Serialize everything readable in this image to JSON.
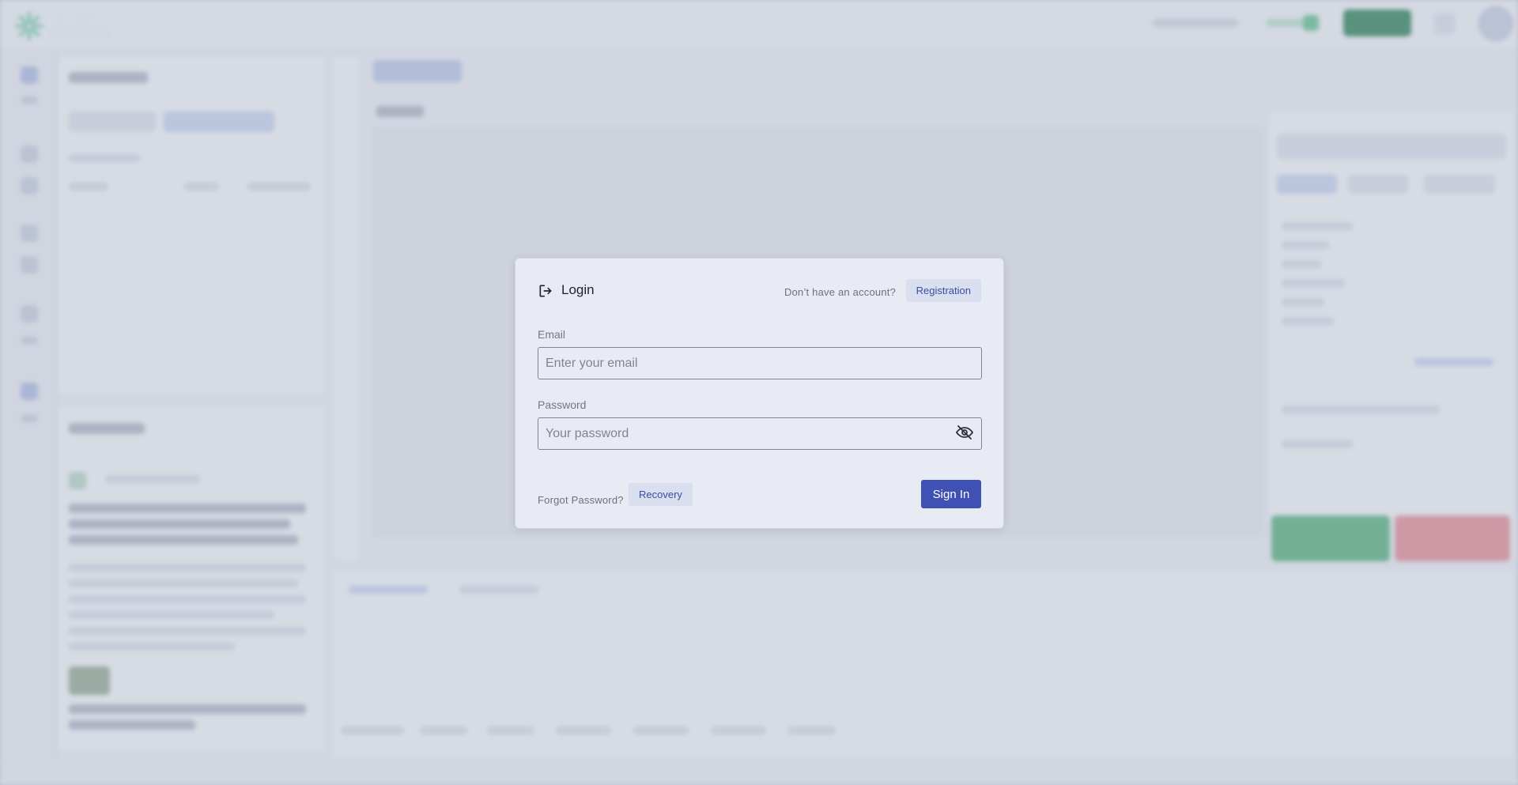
{
  "brand": {
    "name": "ELYSIAN",
    "sub": "CAPITAL",
    "accent": "#2bb673"
  },
  "modal": {
    "title": "Login",
    "no_account_text": "Don’t have an account?",
    "registration_label": "Registration",
    "email": {
      "label": "Email",
      "placeholder": "Enter your email",
      "value": ""
    },
    "password": {
      "label": "Password",
      "placeholder": "Your password",
      "value": ""
    },
    "forgot_text": "Forgot Password?",
    "recovery_label": "Recovery",
    "signin_label": "Sign In",
    "colors": {
      "primary": "#3f51b5",
      "secondary_bg": "#d9dfee",
      "secondary_text": "#3a4ea8"
    }
  }
}
